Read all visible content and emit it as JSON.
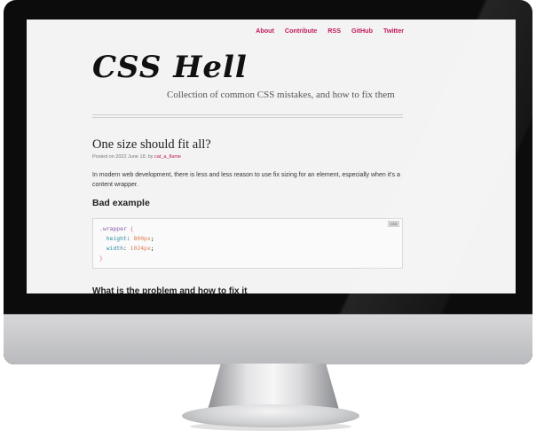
{
  "nav": {
    "items": [
      {
        "label": "About"
      },
      {
        "label": "Contribute"
      },
      {
        "label": "RSS"
      },
      {
        "label": "GitHub"
      },
      {
        "label": "Twitter"
      }
    ]
  },
  "site": {
    "title": "CSS Hell",
    "tagline": "Collection of common CSS mistakes, and how to fix them"
  },
  "post": {
    "title": "One size should fit all?",
    "meta_prefix": "Posted on 2022 June 18. by ",
    "author": "cat_a_flame",
    "intro": "In modern web development, there is less and less reason to use fix sizing for an element, especially when it's a content wrapper.",
    "bad_example_heading": "Bad example",
    "next_heading": "What is the problem and how to fix it"
  },
  "code": {
    "lang": "css",
    "selector": ".wrapper",
    "open_brace": "{",
    "close_brace": "}",
    "decls": [
      {
        "prop": "height",
        "value": "800px"
      },
      {
        "prop": "width",
        "value": "1024px"
      }
    ]
  },
  "colors": {
    "accent": "#c2185b",
    "monitor_frame": "#0c0c0c",
    "screen_bg": "#f3f3f3"
  }
}
